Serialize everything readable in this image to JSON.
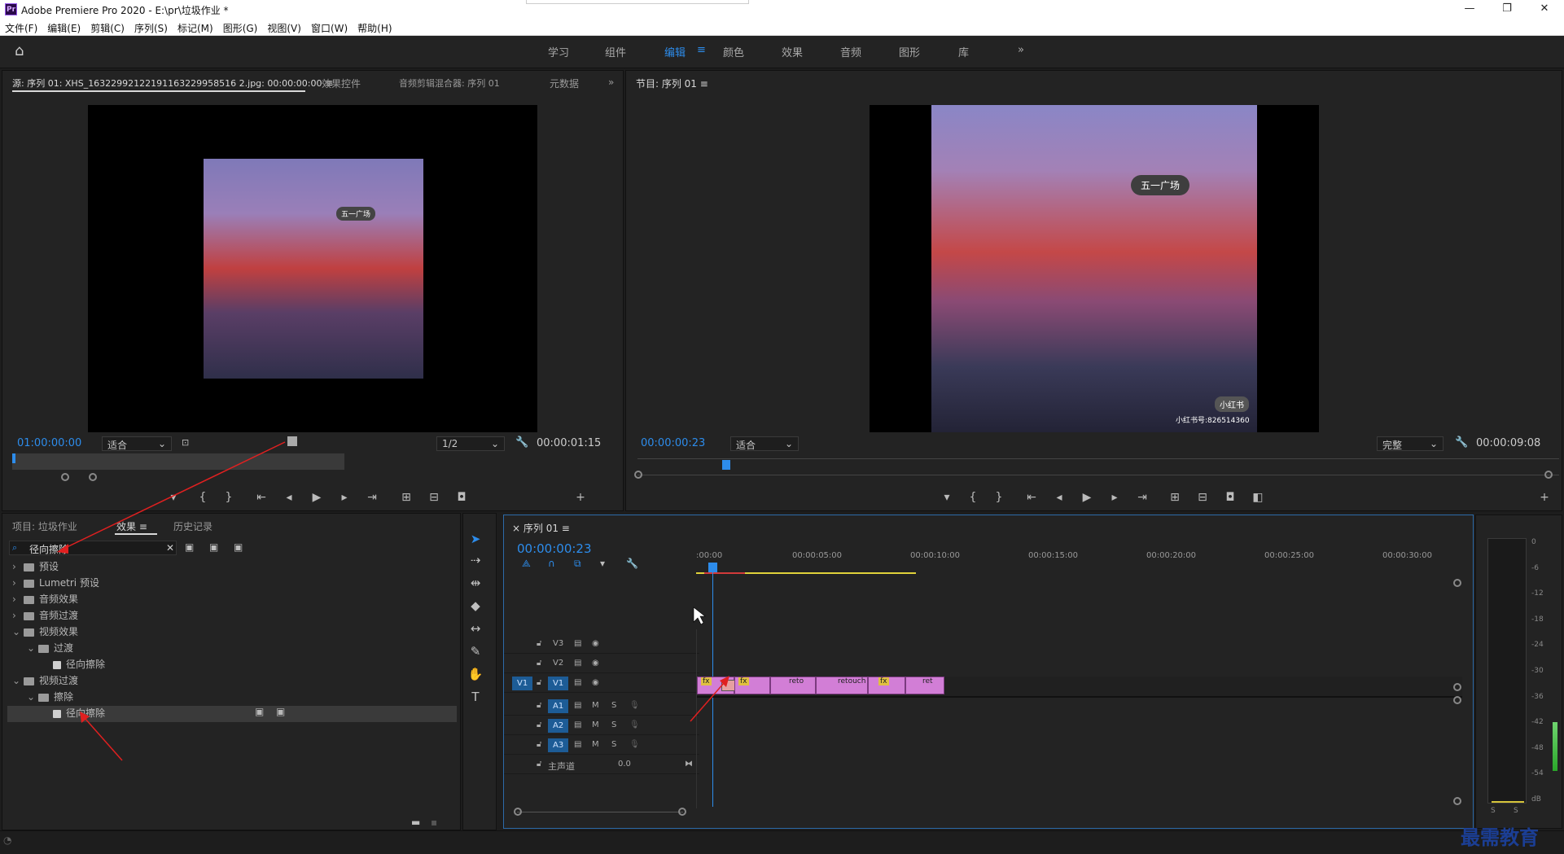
{
  "app": {
    "title": "Adobe Premiere Pro 2020 - E:\\pr\\垃圾作业 *",
    "logo": "Pr"
  },
  "menu": [
    "文件(F)",
    "编辑(E)",
    "剪辑(C)",
    "序列(S)",
    "标记(M)",
    "图形(G)",
    "视图(V)",
    "窗口(W)",
    "帮助(H)"
  ],
  "workspaces": [
    "学习",
    "组件",
    "编辑",
    "颜色",
    "效果",
    "音频",
    "图形",
    "库"
  ],
  "workspace_more": "»",
  "source": {
    "tabs": [
      "源: 序列 01: XHS_16322992122191163229958516 2.jpg: 00:00:00:00",
      "效果控件",
      "音频剪辑混合器: 序列 01",
      "元数据"
    ],
    "timecode": "01:00:00:00",
    "fit": "适合",
    "resolution": "1/2",
    "duration": "00:00:01:15",
    "image_label": "五一广场"
  },
  "program": {
    "tab": "节目: 序列 01",
    "timecode": "00:00:00:23",
    "fit": "适合",
    "quality": "完整",
    "duration": "00:00:09:08",
    "image_label": "五一广场",
    "watermark": "小红书号:826514360",
    "badge": "小红书"
  },
  "effects": {
    "tabs": [
      "项目: 垃圾作业",
      "效果",
      "历史记录"
    ],
    "search": "径向擦除",
    "tree": [
      {
        "label": "预设",
        "indent": 0,
        "open": false,
        "type": "folder"
      },
      {
        "label": "Lumetri 预设",
        "indent": 0,
        "open": false,
        "type": "folder"
      },
      {
        "label": "音频效果",
        "indent": 0,
        "open": false,
        "type": "folder"
      },
      {
        "label": "音频过渡",
        "indent": 0,
        "open": false,
        "type": "folder"
      },
      {
        "label": "视频效果",
        "indent": 0,
        "open": true,
        "type": "folder"
      },
      {
        "label": "过渡",
        "indent": 1,
        "open": true,
        "type": "folder"
      },
      {
        "label": "径向擦除",
        "indent": 2,
        "open": false,
        "type": "effect"
      },
      {
        "label": "视频过渡",
        "indent": 0,
        "open": true,
        "type": "folder"
      },
      {
        "label": "擦除",
        "indent": 1,
        "open": true,
        "type": "folder"
      },
      {
        "label": "径向擦除",
        "indent": 2,
        "open": false,
        "type": "transition",
        "selected": true
      }
    ]
  },
  "timeline": {
    "tab": "序列 01",
    "timecode": "00:00:00:23",
    "ruler": [
      ":00:00",
      "00:00:05:00",
      "00:00:10:00",
      "00:00:15:00",
      "00:00:20:00",
      "00:00:25:00",
      "00:00:30:00"
    ],
    "video_tracks": [
      "V3",
      "V2",
      "V1"
    ],
    "audio_tracks": [
      "A1",
      "A2",
      "A3"
    ],
    "mix_label": "主声道",
    "mix_value": "0.0",
    "source_patch": "V1",
    "clips": [
      "fx",
      "fx",
      "reto",
      "retouch",
      "fx",
      "ret"
    ]
  },
  "meter": {
    "scale": [
      "0",
      "-6",
      "-12",
      "-18",
      "-24",
      "-30",
      "-36",
      "-42",
      "-48",
      "-54",
      "dB"
    ],
    "channels": [
      "S",
      "S"
    ]
  },
  "watermark_brand": "最需教育"
}
